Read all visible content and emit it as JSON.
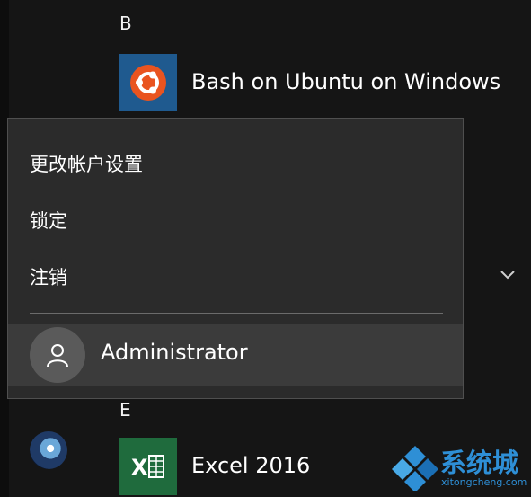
{
  "start_menu": {
    "group_b": "B",
    "app_bash": "Bash on Ubuntu on Windows",
    "group_e": "E",
    "app_excel": "Excel 2016",
    "excel_tile_text": "X"
  },
  "account_menu": {
    "items": [
      {
        "label": "更改帐户设置"
      },
      {
        "label": "锁定"
      },
      {
        "label": "注销"
      }
    ],
    "user_name": "Administrator"
  },
  "watermark": {
    "name": "系统城",
    "domain": "xitongcheng.com"
  },
  "icons": {
    "bash_tile": "ubuntu-logo-icon",
    "excel_tile": "excel-icon",
    "avatar": "user-avatar-icon",
    "chevron": "chevron-down-icon",
    "side": "globe-icon",
    "watermark_logo": "diamond-logo-icon"
  },
  "colors": {
    "background": "#151515",
    "menu_bg": "#2b2b2b",
    "user_row_bg": "#3b3b3b",
    "ubuntu_tile": "#1f5a8f",
    "ubuntu_orange": "#e95420",
    "excel_tile": "#1f6b3d",
    "watermark_blue": "#2e8fd6"
  }
}
